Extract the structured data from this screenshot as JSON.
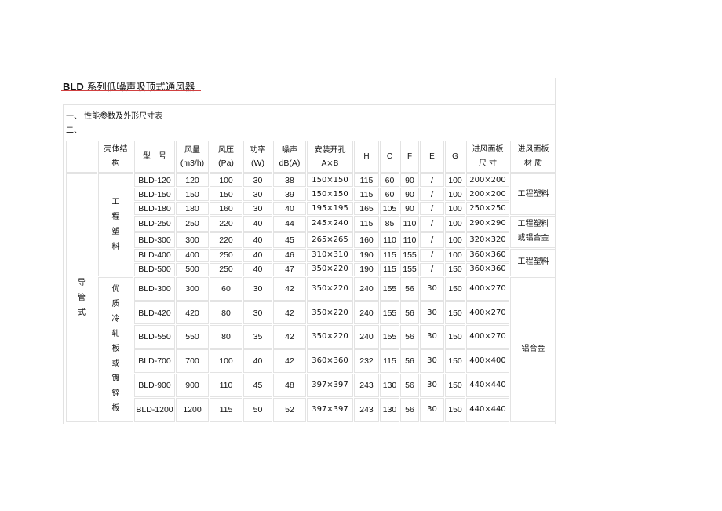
{
  "doc": {
    "title_latin": "BLD",
    "title_cn": "系列低噪声吸顶式通风器",
    "section1": "一、 性能参数及外形尺寸表",
    "section2": "二、"
  },
  "table": {
    "headers": {
      "shell": "壳体结构",
      "model": "型　号",
      "airflow_label": "风量",
      "airflow_unit": "(m3/h)",
      "pressure_label": "风压",
      "pressure_unit": "(Pa)",
      "power_label": "功率",
      "power_unit": "(W)",
      "noise_label": "噪声",
      "noise_unit": "dB(A)",
      "opening_label": "安装开孔",
      "opening_unit": "A×B",
      "H": "H",
      "C": "C",
      "F": "F",
      "E": "E",
      "G": "G",
      "panel_size": "进风面板 尺 寸",
      "panel_material": "进风面板 材 质"
    },
    "group_label": "导管式",
    "shell_groups": [
      "工程塑料",
      "优质冷轧板或镀锌板"
    ],
    "material_groups": [
      "工程塑料",
      "工程塑料或铝合金",
      "工程塑料",
      "铝合金"
    ],
    "rows": [
      {
        "model": "BLD-120",
        "airflow": "120",
        "pressure": "100",
        "power": "30",
        "noise": "38",
        "opening": "150×150",
        "H": "115",
        "C": "60",
        "F": "90",
        "E": "/",
        "G": "100",
        "panel": "200×200"
      },
      {
        "model": "BLD-150",
        "airflow": "150",
        "pressure": "150",
        "power": "30",
        "noise": "39",
        "opening": "150×150",
        "H": "115",
        "C": "60",
        "F": "90",
        "E": "/",
        "G": "100",
        "panel": "200×200"
      },
      {
        "model": "BLD-180",
        "airflow": "180",
        "pressure": "160",
        "power": "30",
        "noise": "40",
        "opening": "195×195",
        "H": "165",
        "C": "105",
        "F": "90",
        "E": "/",
        "G": "100",
        "panel": "250×250"
      },
      {
        "model": "BLD-250",
        "airflow": "250",
        "pressure": "220",
        "power": "40",
        "noise": "44",
        "opening": "245×240",
        "H": "115",
        "C": "85",
        "F": "110",
        "E": "/",
        "G": "100",
        "panel": "290×290"
      },
      {
        "model": "BLD-300",
        "airflow": "300",
        "pressure": "220",
        "power": "40",
        "noise": "45",
        "opening": "265×265",
        "H": "160",
        "C": "110",
        "F": "110",
        "E": "/",
        "G": "100",
        "panel": "320×320"
      },
      {
        "model": "BLD-400",
        "airflow": "400",
        "pressure": "250",
        "power": "40",
        "noise": "46",
        "opening": "310×310",
        "H": "190",
        "C": "115",
        "F": "155",
        "E": "/",
        "G": "100",
        "panel": "360×360"
      },
      {
        "model": "BLD-500",
        "airflow": "500",
        "pressure": "250",
        "power": "40",
        "noise": "47",
        "opening": "350×220",
        "H": "190",
        "C": "115",
        "F": "155",
        "E": "/",
        "G": "150",
        "panel": "360×360"
      },
      {
        "model": "BLD-300",
        "airflow": "300",
        "pressure": "60",
        "power": "30",
        "noise": "42",
        "opening": "350×220",
        "H": "240",
        "C": "155",
        "F": "56",
        "E": "30",
        "G": "150",
        "panel": "400×270"
      },
      {
        "model": "BLD-420",
        "airflow": "420",
        "pressure": "80",
        "power": "30",
        "noise": "42",
        "opening": "350×220",
        "H": "240",
        "C": "155",
        "F": "56",
        "E": "30",
        "G": "150",
        "panel": "400×270"
      },
      {
        "model": "BLD-550",
        "airflow": "550",
        "pressure": "80",
        "power": "35",
        "noise": "42",
        "opening": "350×220",
        "H": "240",
        "C": "155",
        "F": "56",
        "E": "30",
        "G": "150",
        "panel": "400×270"
      },
      {
        "model": "BLD-700",
        "airflow": "700",
        "pressure": "100",
        "power": "40",
        "noise": "42",
        "opening": "360×360",
        "H": "232",
        "C": "115",
        "F": "56",
        "E": "30",
        "G": "150",
        "panel": "400×400"
      },
      {
        "model": "BLD-900",
        "airflow": "900",
        "pressure": "110",
        "power": "45",
        "noise": "48",
        "opening": "397×397",
        "H": "243",
        "C": "130",
        "F": "56",
        "E": "30",
        "G": "150",
        "panel": "440×440"
      },
      {
        "model": "BLD-1200",
        "airflow": "1200",
        "pressure": "115",
        "power": "50",
        "noise": "52",
        "opening": "397×397",
        "H": "243",
        "C": "130",
        "F": "56",
        "E": "30",
        "G": "150",
        "panel": "440×440"
      }
    ]
  }
}
